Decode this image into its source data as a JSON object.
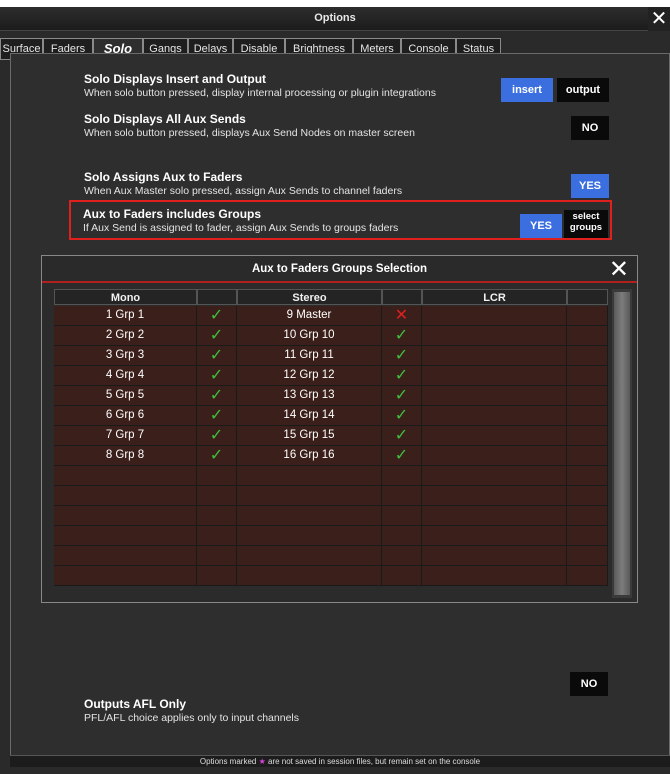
{
  "window": {
    "title": "Options",
    "close": "✕"
  },
  "tabs": [
    {
      "label": "Surface"
    },
    {
      "label": "Faders"
    },
    {
      "label": "Solo"
    },
    {
      "label": "Gangs"
    },
    {
      "label": "Delays"
    },
    {
      "label": "Disable"
    },
    {
      "label": "Brightness"
    },
    {
      "label": "Meters"
    },
    {
      "label": "Console"
    },
    {
      "label": "Status"
    }
  ],
  "active_tab": "Solo",
  "options": [
    {
      "title": "Solo Displays Insert and Output",
      "desc": "When solo button pressed, display internal processing or plugin integrations"
    },
    {
      "title": "Solo Displays All Aux Sends",
      "desc": "When solo button pressed, displays Aux Send Nodes on master screen"
    },
    {
      "title": "Solo Assigns Aux to Faders",
      "desc": "When Aux Master solo pressed, assign Aux Sends to channel faders"
    },
    {
      "title": "Aux to Faders includes Groups",
      "desc": "If Aux Send is assigned to fader, assign Aux Sends to groups faders"
    },
    {
      "title": "Outputs AFL Only",
      "desc": "PFL/AFL choice applies only to input channels"
    }
  ],
  "buttons": {
    "insert": "insert",
    "output": "output",
    "all_aux": "NO",
    "assigns_aux": "YES",
    "groups_yes": "YES",
    "select_groups_1": "select",
    "select_groups_2": "groups",
    "afl_only": "NO"
  },
  "dialog": {
    "title": "Aux to Faders Groups Selection",
    "close": "✕",
    "columns": [
      "Mono",
      "Stereo",
      "LCR"
    ],
    "mono": [
      {
        "name": "1 Grp 1",
        "state": "check"
      },
      {
        "name": "2 Grp 2",
        "state": "check"
      },
      {
        "name": "3 Grp 3",
        "state": "check"
      },
      {
        "name": "4 Grp 4",
        "state": "check"
      },
      {
        "name": "5 Grp 5",
        "state": "check"
      },
      {
        "name": "6 Grp 6",
        "state": "check"
      },
      {
        "name": "7 Grp 7",
        "state": "check"
      },
      {
        "name": "8 Grp 8",
        "state": "check"
      }
    ],
    "stereo": [
      {
        "name": "9 Master",
        "state": "cross"
      },
      {
        "name": "10 Grp 10",
        "state": "check"
      },
      {
        "name": "11 Grp 11",
        "state": "check"
      },
      {
        "name": "12 Grp 12",
        "state": "check"
      },
      {
        "name": "13 Grp 13",
        "state": "check"
      },
      {
        "name": "14 Grp 14",
        "state": "check"
      },
      {
        "name": "15 Grp 15",
        "state": "check"
      },
      {
        "name": "16 Grp 16",
        "state": "check"
      }
    ],
    "check_glyph": "✓",
    "cross_glyph": "✕"
  },
  "footer": {
    "before": "Options marked ",
    "star": "★",
    "after": " are not saved in session files, but remain set on the console"
  },
  "colors": {
    "accent_blue": "#3b6fe0",
    "highlight_red": "#e0201c",
    "check_green": "#3ec03e",
    "cross_red": "#e02020",
    "cell_bg": "#3a1f1a"
  }
}
